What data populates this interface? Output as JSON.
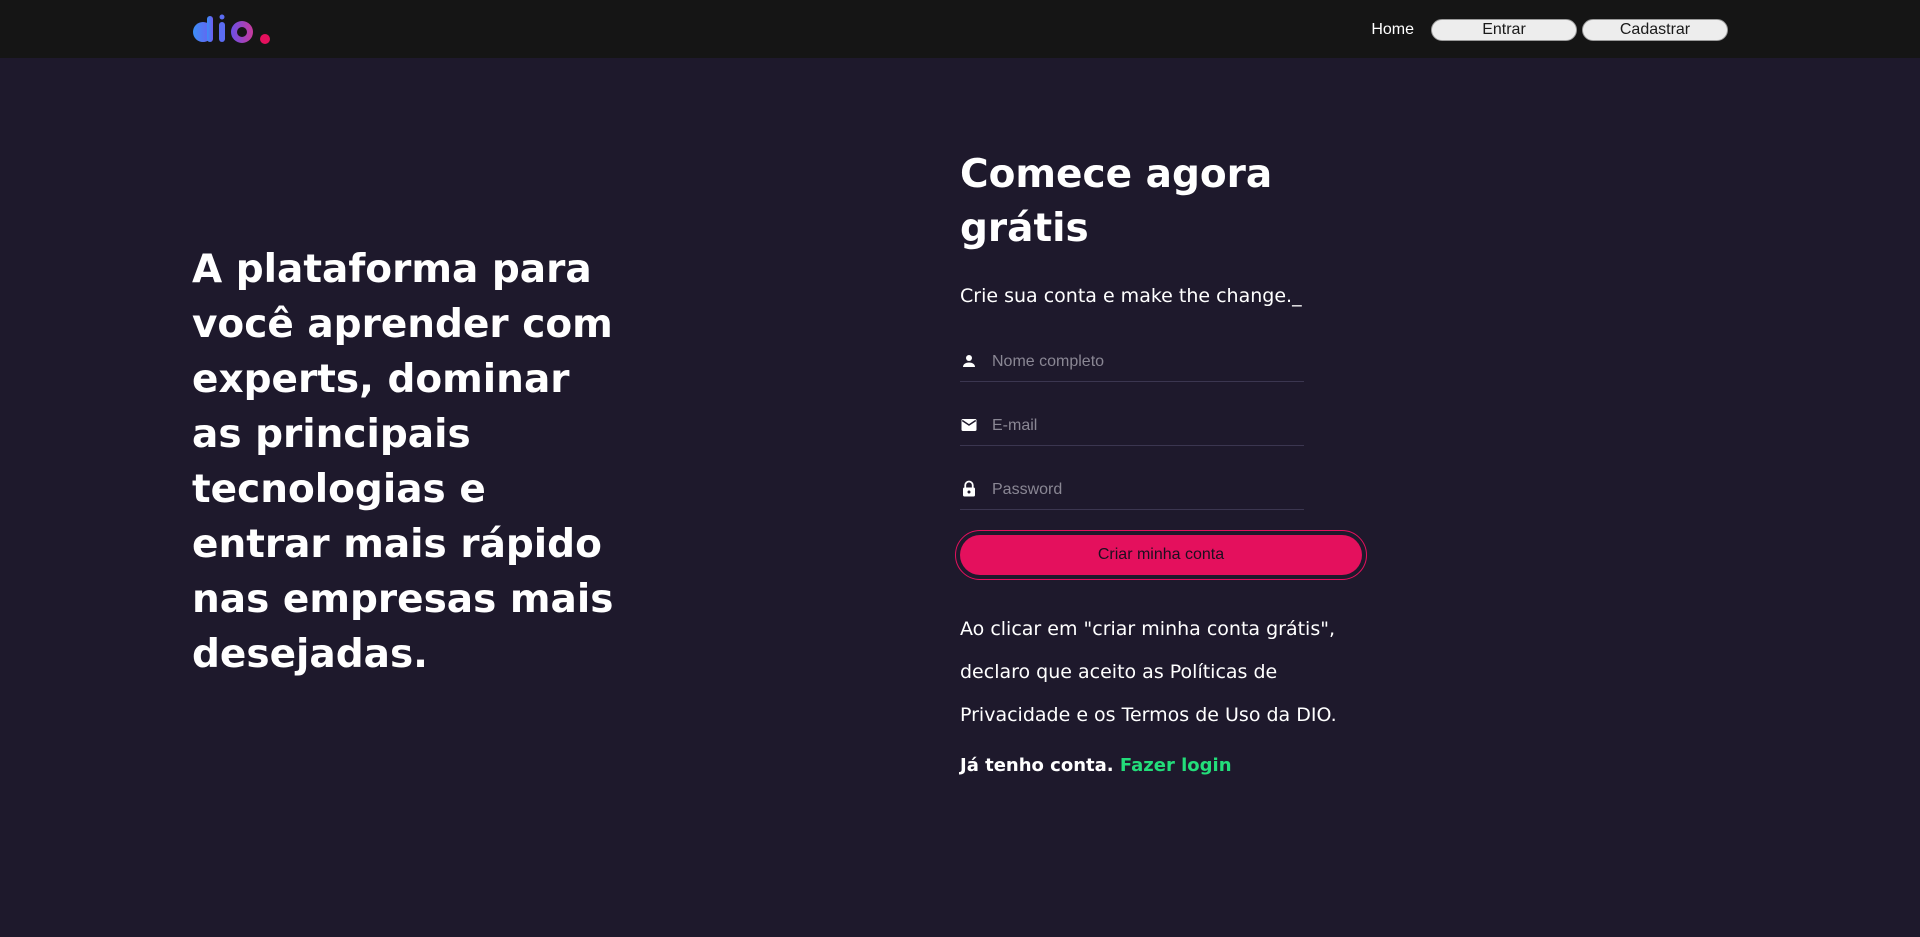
{
  "header": {
    "logo_icon": "dio-logo",
    "nav": {
      "home": "Home",
      "signin": "Entrar",
      "signup": "Cadastrar"
    }
  },
  "hero": {
    "text": "A plataforma para você aprender com experts, dominar as principais tecnologias e entrar mais rápido nas empresas mais desejadas."
  },
  "signup_form": {
    "title": "Comece agora grátis",
    "subtitle": "Crie sua conta e make the change._",
    "fields": [
      {
        "icon": "person-icon",
        "placeholder": "Nome completo",
        "value": ""
      },
      {
        "icon": "mail-icon",
        "placeholder": "E-mail",
        "value": ""
      },
      {
        "icon": "lock-icon",
        "placeholder": "Password",
        "value": ""
      }
    ],
    "submit": "Criar minha conta",
    "terms": "Ao clicar em \"criar minha conta grátis\", declaro que aceito as Políticas de Privacidade e os Termos de Uso da DIO.",
    "login_prefix": "Já tenho conta.",
    "login_link": "Fazer login"
  },
  "colors": {
    "background": "#1e192c",
    "topbar": "#151515",
    "accent": "#e4105d",
    "link": "#23dd7a"
  }
}
